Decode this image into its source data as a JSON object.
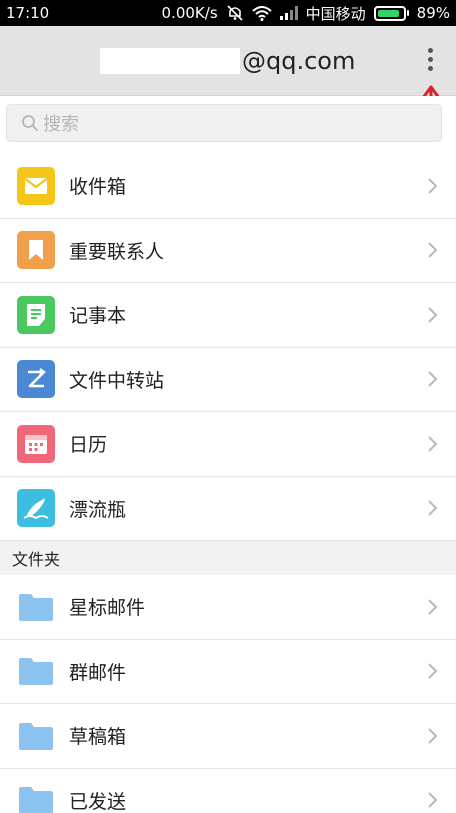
{
  "status_bar": {
    "time": "17:10",
    "speed": "0.00K/s",
    "carrier": "中国移动",
    "battery": "89%",
    "battery_level": 0.89,
    "battery_color": "#35d26a",
    "icons": [
      "mute-icon",
      "wifi-icon",
      "signal-icon",
      "battery-icon"
    ]
  },
  "header": {
    "account_suffix": "@qq.com",
    "menu_icon": "more-vertical-icon"
  },
  "search": {
    "placeholder": "搜索",
    "icon": "search-icon"
  },
  "mailboxes": [
    {
      "label": "收件箱",
      "icon": "envelope-icon",
      "color": "#f5c518"
    },
    {
      "label": "重要联系人",
      "icon": "bookmark-icon",
      "color": "#f0a04b"
    },
    {
      "label": "记事本",
      "icon": "notepad-icon",
      "color": "#4cc860"
    },
    {
      "label": "文件中转站",
      "icon": "transfer-icon",
      "color": "#4a88d6"
    },
    {
      "label": "日历",
      "icon": "calendar-icon",
      "color": "#f06779"
    },
    {
      "label": "漂流瓶",
      "icon": "drift-bottle-icon",
      "color": "#3dbde0"
    }
  ],
  "folders_section": {
    "title": "文件夹",
    "items": [
      {
        "label": "星标邮件",
        "icon": "folder-icon"
      },
      {
        "label": "群邮件",
        "icon": "folder-icon"
      },
      {
        "label": "草稿箱",
        "icon": "folder-icon"
      },
      {
        "label": "已发送",
        "icon": "folder-icon"
      }
    ],
    "folder_color": "#8cc3f0"
  },
  "annotation_color": "#d9232d"
}
